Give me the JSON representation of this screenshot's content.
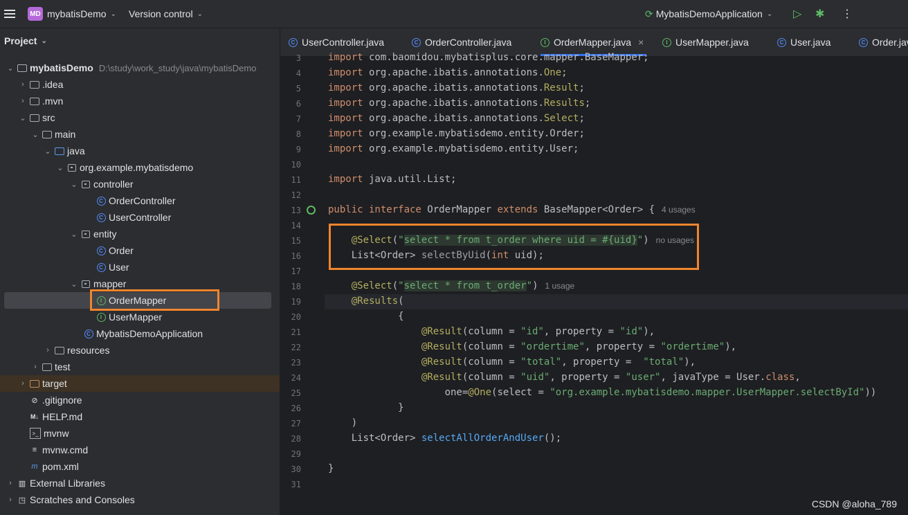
{
  "titlebar": {
    "project_badge": "MD",
    "project_name": "mybatisDemo",
    "vcs": "Version control",
    "run_config": "MybatisDemoApplication"
  },
  "panel": {
    "title": "Project"
  },
  "tree": [
    {
      "label": "mybatisDemo",
      "path": "D:\\study\\work_study\\java\\mybatisDemo"
    },
    {
      "label": ".idea"
    },
    {
      "label": ".mvn"
    },
    {
      "label": "src"
    },
    {
      "label": "main"
    },
    {
      "label": "java"
    },
    {
      "label": "org.example.mybatisdemo"
    },
    {
      "label": "controller"
    },
    {
      "label": "OrderController"
    },
    {
      "label": "UserController"
    },
    {
      "label": "entity"
    },
    {
      "label": "Order"
    },
    {
      "label": "User"
    },
    {
      "label": "mapper"
    },
    {
      "label": "OrderMapper"
    },
    {
      "label": "UserMapper"
    },
    {
      "label": "MybatisDemoApplication"
    },
    {
      "label": "resources"
    },
    {
      "label": "test"
    },
    {
      "label": "target"
    },
    {
      "label": ".gitignore"
    },
    {
      "label": "HELP.md"
    },
    {
      "label": "mvnw"
    },
    {
      "label": "mvnw.cmd"
    },
    {
      "label": "pom.xml"
    },
    {
      "label": "External Libraries"
    },
    {
      "label": "Scratches and Consoles"
    }
  ],
  "tabs": [
    {
      "label": "UserController.java"
    },
    {
      "label": "OrderController.java"
    },
    {
      "label": "OrderMapper.java"
    },
    {
      "label": "UserMapper.java"
    },
    {
      "label": "User.java"
    },
    {
      "label": "Order.java"
    }
  ],
  "editor": {
    "line_numbers": [
      "3",
      "4",
      "5",
      "6",
      "7",
      "8",
      "9",
      "10",
      "11",
      "12",
      "13",
      "14",
      "15",
      "16",
      "17",
      "18",
      "19",
      "20",
      "21",
      "22",
      "23",
      "24",
      "25",
      "26",
      "27",
      "28",
      "29",
      "30",
      "31"
    ],
    "hints": {
      "l13": "4 usages",
      "l15": "no usages",
      "l18": "1 usage"
    }
  },
  "watermark": "CSDN @aloha_789"
}
